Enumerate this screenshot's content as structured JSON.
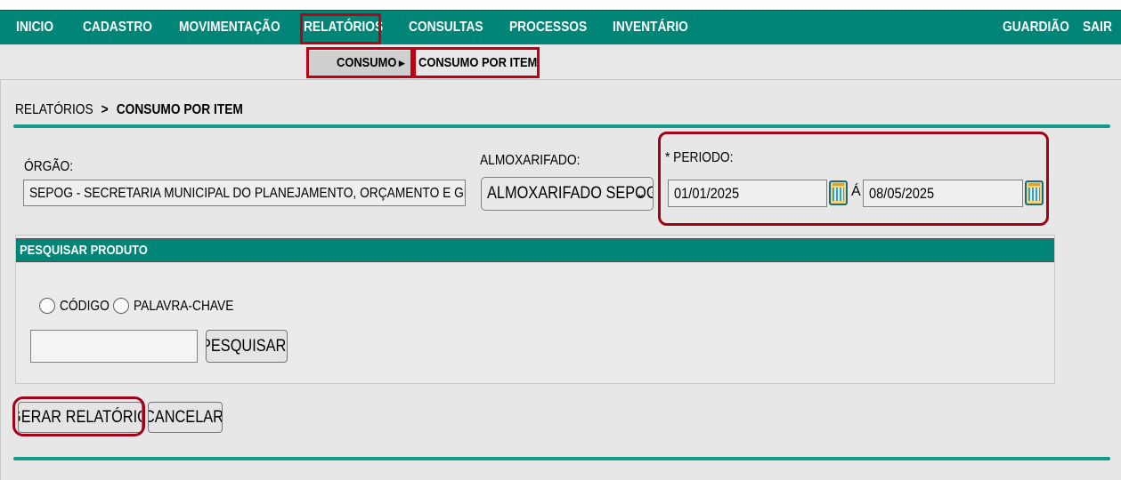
{
  "nav": {
    "inicio": "INICIO",
    "cadastro": "CADASTRO",
    "movimentacao": "MOVIMENTAÇÃO",
    "relatorios": "RELATÓRIOS",
    "consultas": "CONSULTAS",
    "processos": "PROCESSOS",
    "inventario": "INVENTÁRIO",
    "guardiao": "GUARDIÃO",
    "sair": "SAIR"
  },
  "submenu": {
    "consumo": "CONSUMO",
    "consumo_arrow": "▸",
    "consumo_por_item": "CONSUMO POR ITEM"
  },
  "breadcrumb": {
    "parent": "RELATÓRIOS",
    "separator": ">",
    "current": "CONSUMO POR ITEM"
  },
  "form": {
    "orgao_label": "ÓRGÃO:",
    "orgao_value": "SEPOG - SECRETARIA MUNICIPAL DO PLANEJAMENTO, ORÇAMENTO E GESTÃO",
    "almox_label": "ALMOXARIFADO:",
    "almox_value": "ALMOXARIFADO SEPOG",
    "periodo_label": "* PERIODO:",
    "periodo_start": "01/01/2025",
    "periodo_sep": "Á",
    "periodo_end": "08/05/2025"
  },
  "search": {
    "header": "PESQUISAR PRODUTO",
    "radio_codigo": "CÓDIGO",
    "radio_palavra": "PALAVRA-CHAVE",
    "input_value": "",
    "button": "PESQUISAR"
  },
  "actions": {
    "gerar": "GERAR RELATÓRIO",
    "cancelar": "CANCELAR"
  },
  "colors": {
    "nav_bg": "#008577",
    "highlight": "#c00012",
    "accent_line": "#139b8e"
  }
}
